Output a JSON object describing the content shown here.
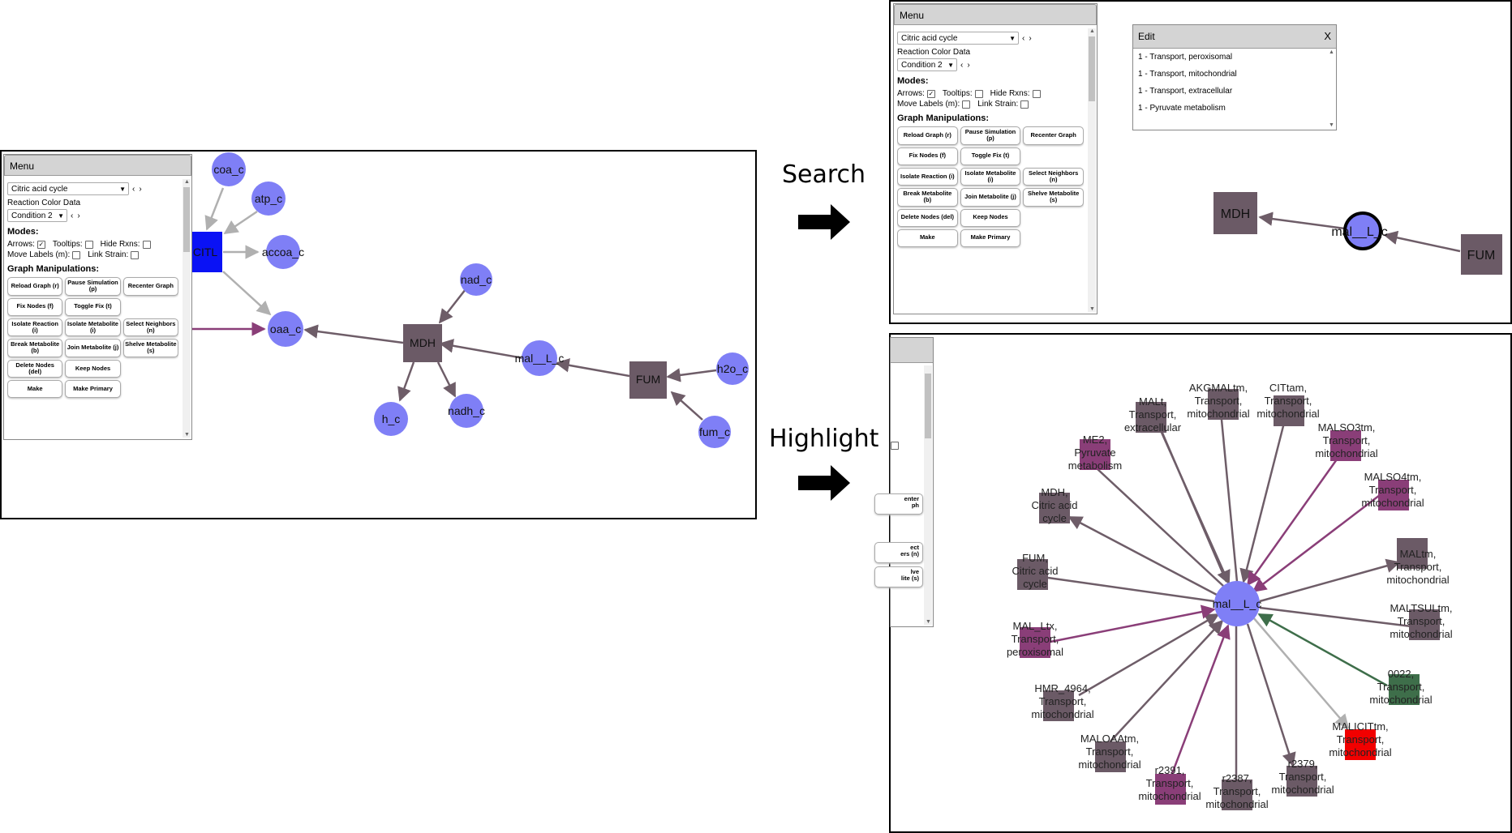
{
  "menu": {
    "title": "Menu",
    "pathway": "Citric acid cycle",
    "reaction_color_label": "Reaction Color Data",
    "condition": "Condition 2",
    "modes_header": "Modes:",
    "arrows_label": "Arrows:",
    "tooltips_label": "Tooltips:",
    "hide_rxns_label": "Hide Rxns:",
    "move_labels_label": "Move Labels (m):",
    "link_strain_label": "Link Strain:",
    "graph_manip_header": "Graph Manipulations:",
    "buttons": [
      {
        "label": "Reload Graph (r)"
      },
      {
        "label": "Pause Simulation (p)"
      },
      {
        "label": "Recenter Graph"
      },
      {
        "label": "Fix Nodes (f)"
      },
      {
        "label": "Toggle Fix (t)"
      },
      {
        "label": ""
      },
      {
        "label": "Isolate Reaction (i)"
      },
      {
        "label": "Isolate Metabolite (i)"
      },
      {
        "label": "Select Neighbors (n)"
      },
      {
        "label": "Break Metabolite (b)"
      },
      {
        "label": "Join Metabolite (j)"
      },
      {
        "label": "Shelve Metabolite (s)"
      },
      {
        "label": "Delete Nodes (del)"
      },
      {
        "label": "Keep Nodes"
      },
      {
        "label": ""
      },
      {
        "label": "Make"
      },
      {
        "label": "Make Primary"
      },
      {
        "label": ""
      }
    ]
  },
  "steps": {
    "search": "Search",
    "highlight": "Highlight"
  },
  "edit": {
    "title": "Edit",
    "close": "X",
    "items": [
      "1 - Transport, peroxisomal",
      "1 - Transport, mitochondrial",
      "1 - Transport, extracellular",
      "1 - Pyruvate metabolism"
    ]
  },
  "stub_buttons": [
    "enter\nph",
    "ect\ners (n)",
    "lve\nlite (s)"
  ],
  "colors": {
    "metabolite": "#7f7ff6",
    "reaction": "#6b5a66",
    "reaction_magenta": "#8a3e78",
    "reaction_green": "#3e6e4a",
    "reaction_red": "#f20000",
    "citl_blue": "#0a12f5",
    "edge_gray": "#b0b0b0",
    "edge_dark": "#6e5d68"
  },
  "panel1": {
    "metabolites": [
      {
        "id": "coa_c",
        "label": "coa_c"
      },
      {
        "id": "atp_c",
        "label": "atp_c"
      },
      {
        "id": "accoa_c",
        "label": "accoa_c"
      },
      {
        "id": "oaa_c",
        "label": "oaa_c"
      },
      {
        "id": "nad_c",
        "label": "nad_c"
      },
      {
        "id": "h_c",
        "label": "h_c"
      },
      {
        "id": "nadh_c",
        "label": "nadh_c"
      },
      {
        "id": "mal__L_c",
        "label": "mal__L_c"
      },
      {
        "id": "h2o_c",
        "label": "h2o_c"
      },
      {
        "id": "fum_c",
        "label": "fum_c"
      }
    ],
    "reactions": [
      {
        "id": "CITL",
        "label": "CITL"
      },
      {
        "id": "MDH",
        "label": "MDH"
      },
      {
        "id": "FUM",
        "label": "FUM"
      }
    ]
  },
  "panel2": {
    "nodes": [
      {
        "id": "MDH",
        "label": "MDH"
      },
      {
        "id": "mal__L_c",
        "label": "mal__L_c"
      },
      {
        "id": "FUM",
        "label": "FUM"
      }
    ]
  },
  "panel3": {
    "center": "mal__L_c",
    "reactions": [
      {
        "id": "AKGMALtm",
        "label": [
          "AKGMALtm,",
          "Transport,",
          "mitochondrial"
        ]
      },
      {
        "id": "CITtam",
        "label": [
          "CITtam,",
          "Transport,",
          "mitochondrial"
        ]
      },
      {
        "id": "MALSO3tm",
        "label": [
          "MALSO3tm,",
          "Transport,",
          "mitochondrial"
        ]
      },
      {
        "id": "MALSO4tm",
        "label": [
          "MALSO4tm,",
          "Transport,",
          "mitochondrial"
        ]
      },
      {
        "id": "MALtm",
        "label": [
          "MALtm,",
          "Transport,",
          "mitochondrial"
        ]
      },
      {
        "id": "MALTSULtm",
        "label": [
          "MALTSULtm,",
          "Transport,",
          "mitochondrial"
        ]
      },
      {
        "id": "0022",
        "label": [
          "0022,",
          "Transport,",
          "mitochondrial"
        ]
      },
      {
        "id": "MALICITtm",
        "label": [
          "MALICITtm,",
          "Transport,",
          "mitochondrial"
        ]
      },
      {
        "id": "r2379",
        "label": [
          "r2379,",
          "Transport,",
          "mitochondrial"
        ]
      },
      {
        "id": "r2387",
        "label": [
          "r2387,",
          "Transport,",
          "mitochondrial"
        ]
      },
      {
        "id": "r2391",
        "label": [
          "r2391,",
          "Transport,",
          "mitochondrial"
        ]
      },
      {
        "id": "MALOAAtm",
        "label": [
          "MALOAAtm,",
          "Transport,",
          "mitochondrial"
        ]
      },
      {
        "id": "HMR_4964",
        "label": [
          "HMR_4964,",
          "Transport,",
          "mitochondrial"
        ]
      },
      {
        "id": "MAL_Ltx",
        "label": [
          "MAL_Ltx,",
          "Transport,",
          "peroxisomal"
        ]
      },
      {
        "id": "FUM",
        "label": [
          "FUM,",
          "Citric acid",
          "cycle"
        ]
      },
      {
        "id": "MDH",
        "label": [
          "MDH,",
          "Citric acid",
          "cycle"
        ]
      },
      {
        "id": "ME2",
        "label": [
          "ME2,",
          "Pyruvate",
          "metabolism"
        ]
      },
      {
        "id": "MALt",
        "label": [
          "MALt,",
          "Transport,",
          "extracellular"
        ]
      }
    ]
  }
}
